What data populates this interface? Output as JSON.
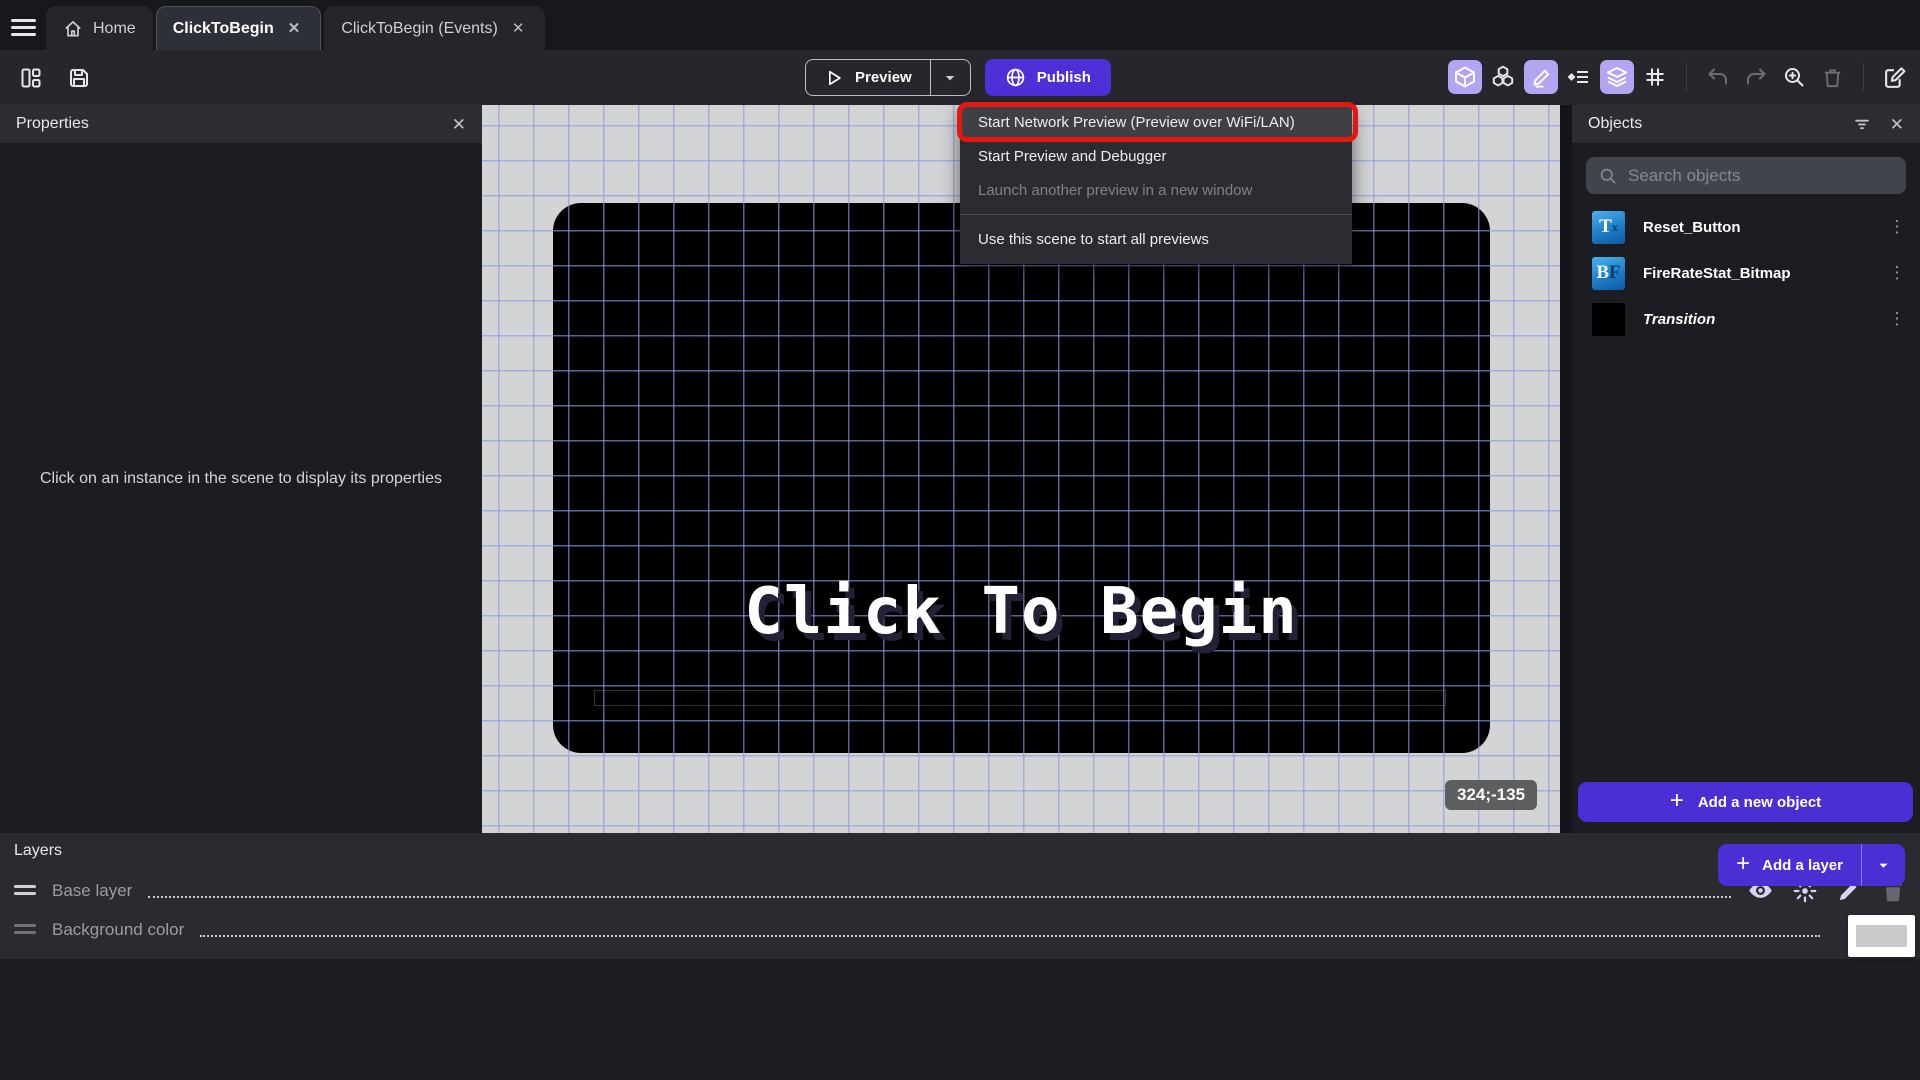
{
  "tabbar": {
    "tabs": [
      {
        "label": "Home"
      },
      {
        "label": "ClickToBegin",
        "active": true,
        "close": "✕"
      },
      {
        "label": "ClickToBegin (Events)",
        "close": "✕"
      }
    ]
  },
  "toolbar": {
    "preview_label": "Preview",
    "publish_label": "Publish",
    "left_icons": [
      "project-manager-icon",
      "save-icon"
    ],
    "right_icons": [
      "3d-view-icon (active)",
      "objects-list-icon",
      "properties-edit-icon (active)",
      "instances-list-icon",
      "layers-icon (active)",
      "grid-icon",
      "undo-icon (disabled)",
      "redo-icon (disabled)",
      "zoom-in-icon",
      "trash-icon (disabled)",
      "edit-scene-icon"
    ]
  },
  "preview_menu": {
    "items": [
      {
        "label": "Start Network Preview (Preview over WiFi/LAN)",
        "state": "highlighted-with-red-annotation"
      },
      {
        "label": "Start Preview and Debugger",
        "state": "normal"
      },
      {
        "label": "Launch another preview in a new window",
        "state": "disabled"
      },
      {
        "label": "Use this scene to start all previews",
        "state": "normal"
      }
    ]
  },
  "properties_panel": {
    "title": "Properties",
    "close": "✕",
    "empty_message": "Click on an instance in the scene to display its properties"
  },
  "canvas": {
    "game_title_text": "Click To Begin",
    "cursor_coordinates": "324;-135"
  },
  "objects_panel": {
    "title": "Objects",
    "close": "✕",
    "search_placeholder": "Search objects",
    "objects": [
      {
        "name": "Reset_Button",
        "icon": "text-object-icon",
        "icon_main": "T",
        "icon_sub": "x"
      },
      {
        "name": "FireRateStat_Bitmap",
        "icon": "bitmap-font-object-icon",
        "icon_main": "B",
        "icon_sub": "F"
      },
      {
        "name": "Transition",
        "icon": "black-swatch-icon",
        "italic": true
      }
    ],
    "kebab_glyph": "⋮",
    "add_button_label": "Add a new object",
    "plus_glyph": "+"
  },
  "layers_panel": {
    "title": "Layers",
    "close": "✕",
    "layers": [
      {
        "name": "Base layer",
        "icons": [
          "eye-icon",
          "effects-icon",
          "edit-icon",
          "trash-icon (disabled)"
        ]
      },
      {
        "name": "Background color",
        "swatch_color": "#c9cacb"
      }
    ],
    "add_button_label": "Add a layer",
    "plus_glyph": "+"
  },
  "colors": {
    "accent_purple": "#4b2fd4",
    "publish_purple": "#4f2fd8",
    "active_icon_lavender": "#b3a5f1",
    "annotation_red": "#e3170d",
    "canvas_gray": "#d3d4d6",
    "grid_blue": "#8a9ae0",
    "panel_dark": "#1b1d23",
    "header_dark": "#2b2d33"
  }
}
